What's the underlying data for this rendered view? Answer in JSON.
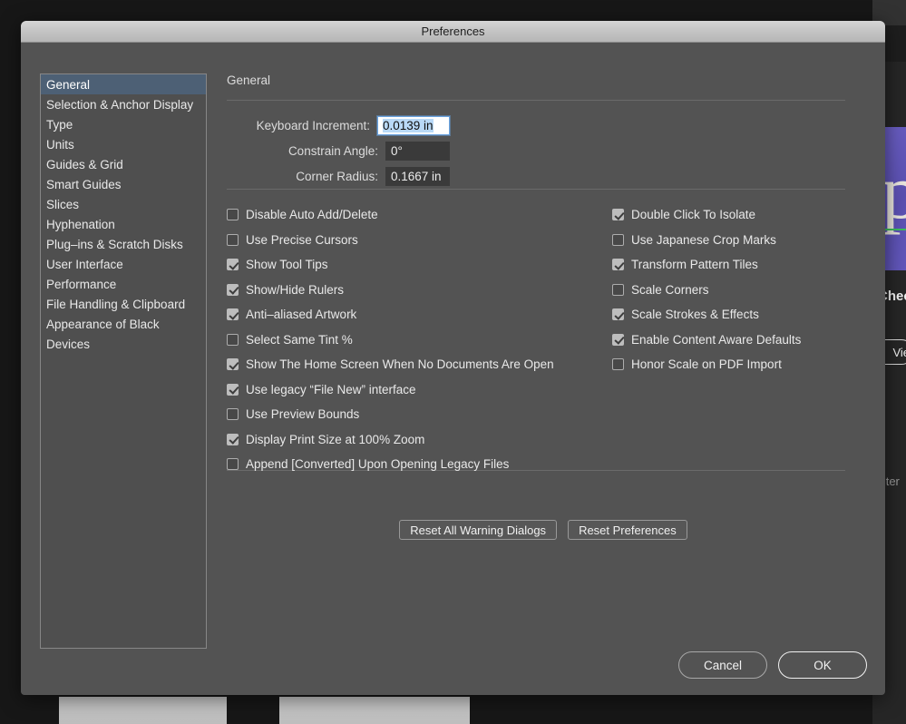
{
  "background": {
    "card_title": "Chec",
    "card_button": "Vie",
    "filter_label": "Filter",
    "card_glyph": "p"
  },
  "dialog": {
    "title": "Preferences",
    "pane_heading": "General",
    "sidebar": {
      "items": [
        {
          "label": "General",
          "selected": true
        },
        {
          "label": "Selection & Anchor Display",
          "selected": false
        },
        {
          "label": "Type",
          "selected": false
        },
        {
          "label": "Units",
          "selected": false
        },
        {
          "label": "Guides & Grid",
          "selected": false
        },
        {
          "label": "Smart Guides",
          "selected": false
        },
        {
          "label": "Slices",
          "selected": false
        },
        {
          "label": "Hyphenation",
          "selected": false
        },
        {
          "label": "Plug–ins & Scratch Disks",
          "selected": false
        },
        {
          "label": "User Interface",
          "selected": false
        },
        {
          "label": "Performance",
          "selected": false
        },
        {
          "label": "File Handling & Clipboard",
          "selected": false
        },
        {
          "label": "Appearance of Black",
          "selected": false
        },
        {
          "label": "Devices",
          "selected": false
        }
      ]
    },
    "fields": [
      {
        "label": "Keyboard Increment:",
        "value": "0.0139 in",
        "focused": true,
        "width": "wide"
      },
      {
        "label": "Constrain Angle:",
        "value": "0°",
        "focused": false,
        "width": "narrow"
      },
      {
        "label": "Corner Radius:",
        "value": "0.1667 in",
        "focused": false,
        "width": "narrow"
      }
    ],
    "checkboxes_left": [
      {
        "label": "Disable Auto Add/Delete",
        "checked": false
      },
      {
        "label": "Use Precise Cursors",
        "checked": false
      },
      {
        "label": "Show Tool Tips",
        "checked": true
      },
      {
        "label": "Show/Hide Rulers",
        "checked": true
      },
      {
        "label": "Anti–aliased Artwork",
        "checked": true
      },
      {
        "label": "Select Same Tint %",
        "checked": false
      },
      {
        "label": "Show The Home Screen When No Documents Are Open",
        "checked": true
      },
      {
        "label": "Use legacy “File New” interface",
        "checked": true
      },
      {
        "label": "Use Preview Bounds",
        "checked": false
      },
      {
        "label": "Display Print Size at 100% Zoom",
        "checked": true
      },
      {
        "label": "Append [Converted] Upon Opening Legacy Files",
        "checked": false
      }
    ],
    "checkboxes_right": [
      {
        "label": "Double Click To Isolate",
        "checked": true
      },
      {
        "label": "Use Japanese Crop Marks",
        "checked": false
      },
      {
        "label": "Transform Pattern Tiles",
        "checked": true
      },
      {
        "label": "Scale Corners",
        "checked": false
      },
      {
        "label": "Scale Strokes & Effects",
        "checked": true
      },
      {
        "label": "Enable Content Aware Defaults",
        "checked": true
      },
      {
        "label": "Honor Scale on PDF Import",
        "checked": false
      }
    ],
    "reset_buttons": [
      {
        "label": "Reset All Warning Dialogs"
      },
      {
        "label": "Reset Preferences"
      }
    ],
    "footer_buttons": [
      {
        "label": "Cancel",
        "kind": "cancel"
      },
      {
        "label": "OK",
        "kind": "ok"
      }
    ]
  },
  "colors": {
    "dialog_bg": "#535353",
    "sidebar_bg": "#4f4f4f",
    "selection": "#4d6075",
    "field_bg": "#3a3a3a",
    "focus_border": "#6aa3e0",
    "text_selection": "#b9d9f7",
    "checkbox_on": "#bdbdbd",
    "desktop_bg": "#171717"
  }
}
